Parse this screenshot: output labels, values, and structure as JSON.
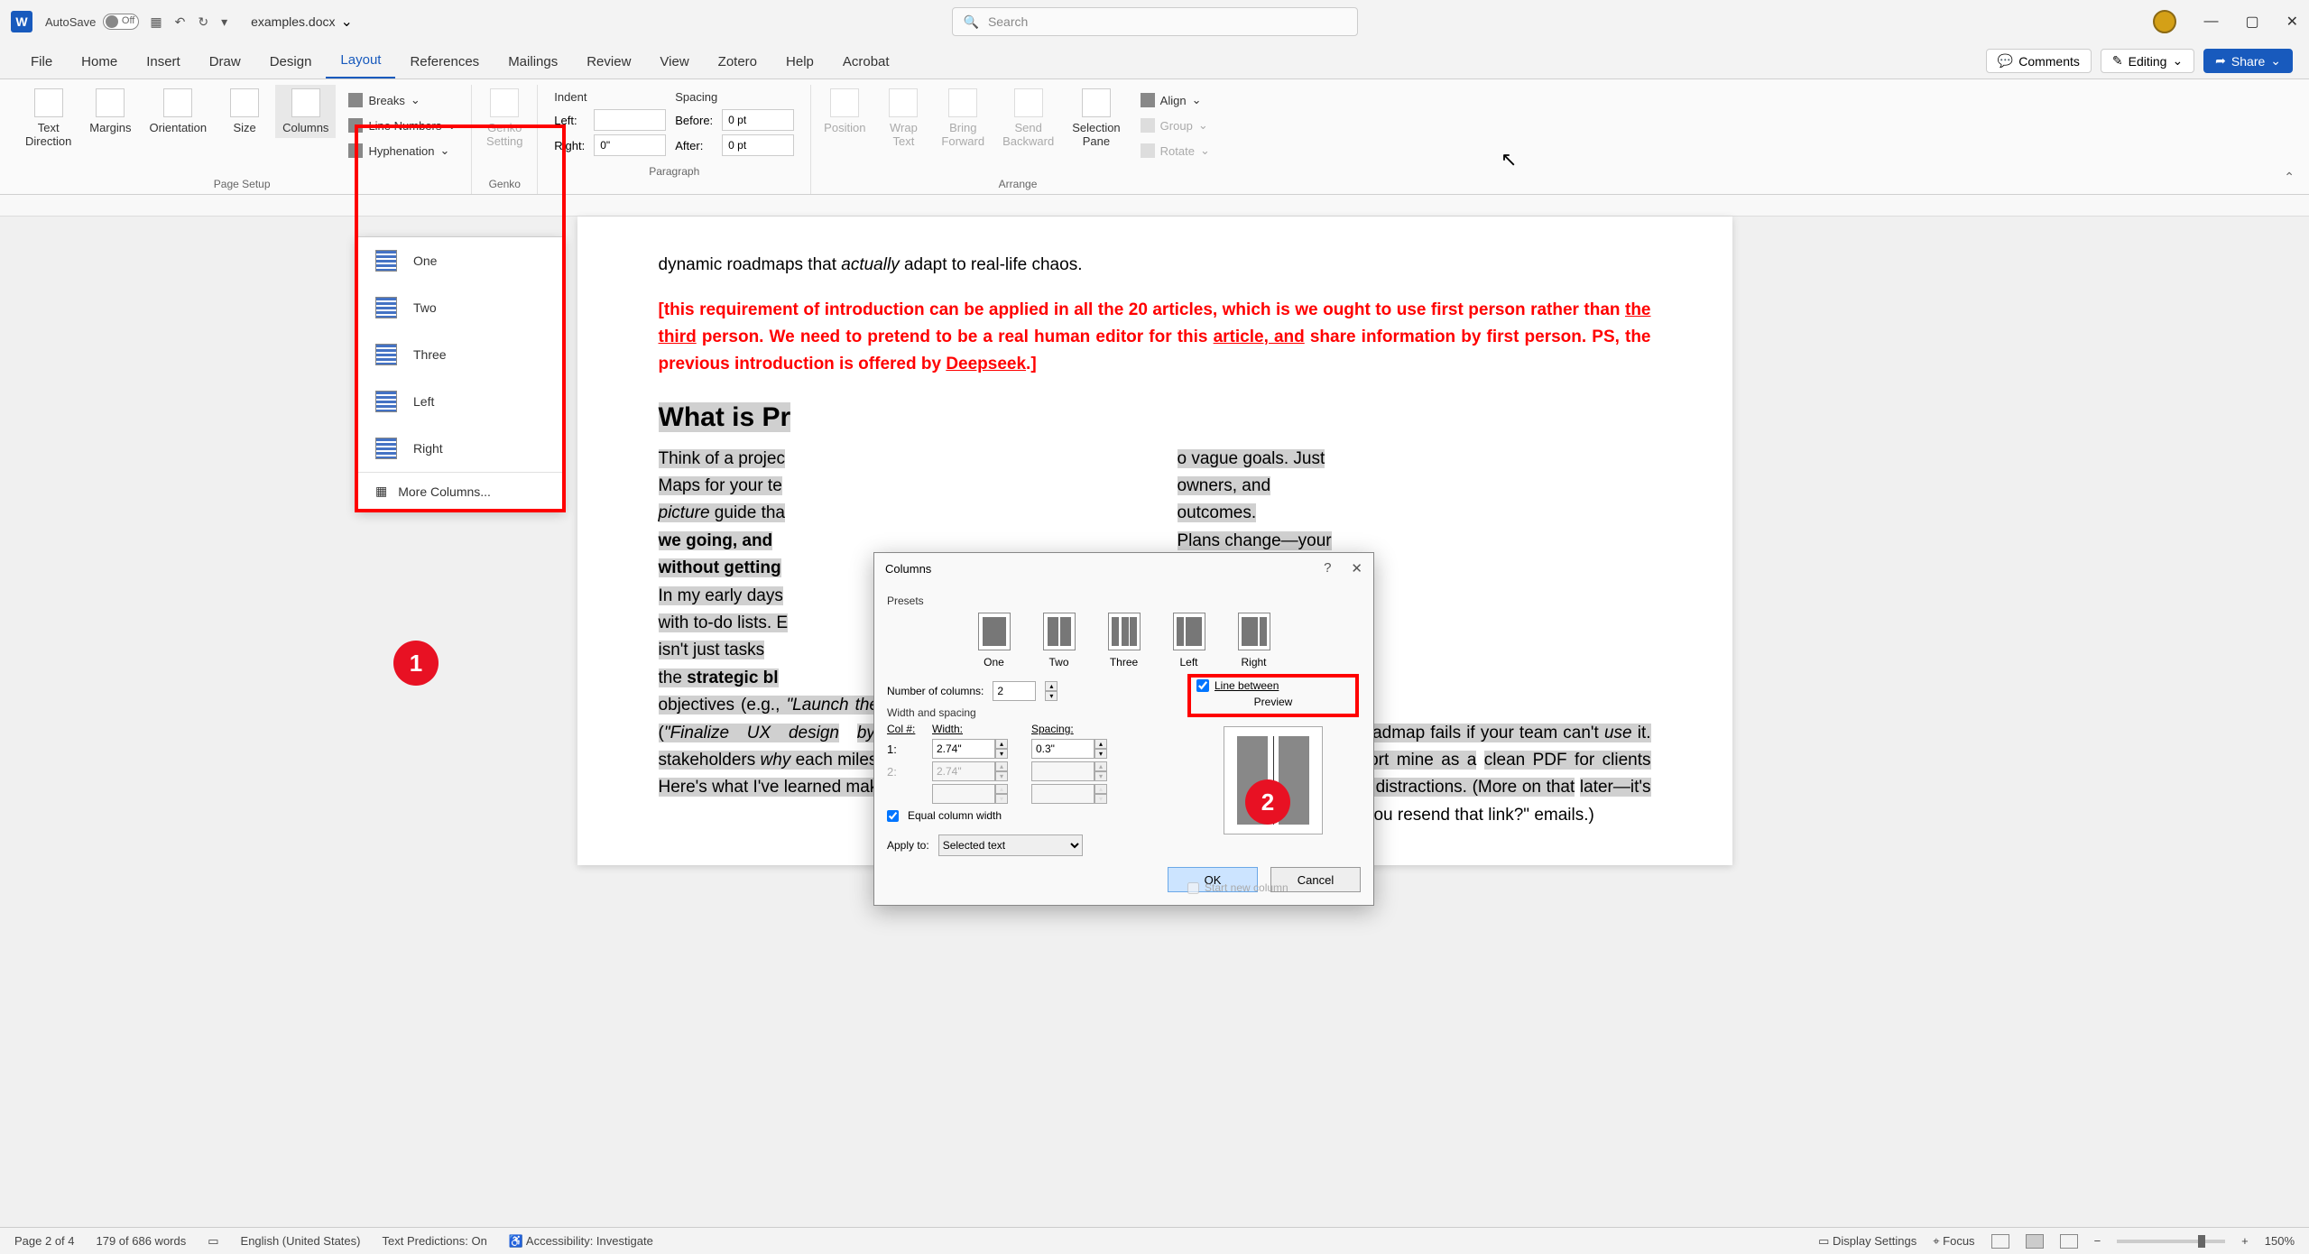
{
  "titlebar": {
    "autosave": "AutoSave",
    "autosave_state": "Off",
    "docname": "examples.docx",
    "search_placeholder": "Search"
  },
  "tabs": {
    "items": [
      "File",
      "Home",
      "Insert",
      "Draw",
      "Design",
      "Layout",
      "References",
      "Mailings",
      "Review",
      "View",
      "Zotero",
      "Help",
      "Acrobat"
    ],
    "active": "Layout",
    "comments": "Comments",
    "editing": "Editing",
    "share": "Share"
  },
  "ribbon": {
    "page_setup": {
      "text_direction": "Text\nDirection",
      "margins": "Margins",
      "orientation": "Orientation",
      "size": "Size",
      "columns": "Columns",
      "breaks": "Breaks",
      "line_numbers": "Line Numbers",
      "hyphenation": "Hyphenation",
      "label": "Page Setup"
    },
    "genko": {
      "btn": "Genko\nSetting",
      "label": "Genko"
    },
    "paragraph": {
      "indent_hdr": "Indent",
      "spacing_hdr": "Spacing",
      "left_lbl": "Left:",
      "left_val": "",
      "right_lbl": "Right:",
      "right_val": "0\"",
      "before_lbl": "Before:",
      "before_val": "0 pt",
      "after_lbl": "After:",
      "after_val": "0 pt",
      "label": "Paragraph"
    },
    "arrange": {
      "position": "Position",
      "wrap_text": "Wrap\nText",
      "bring_forward": "Bring\nForward",
      "send_backward": "Send\nBackward",
      "selection_pane": "Selection\nPane",
      "align": "Align",
      "group": "Group",
      "rotate": "Rotate",
      "label": "Arrange"
    }
  },
  "columns_menu": {
    "one": "One",
    "two": "Two",
    "three": "Three",
    "left": "Left",
    "right": "Right",
    "more": "More Columns..."
  },
  "badges": {
    "one": "1",
    "two": "2"
  },
  "document": {
    "intro_tail": "dynamic roadmaps that actually adapt to real-life chaos.",
    "red_note_1": "[this requirement of introduction can be applied in all the 20 articles, which is we ought to use first person rather than ",
    "red_note_third": "the third",
    "red_note_2": " person. We need to pretend to be a real human editor for this ",
    "red_note_article": "article, and",
    "red_note_3": " share information by first person. PS, the previous introduction is offered by ",
    "red_note_deepseek": "Deepseek",
    "red_note_4": ".]",
    "heading": "What is Pr",
    "col_left": "Think of a project<br>Maps for your tea<br><em>picture</em> guide tha<br><strong>we going, and</strong><br><strong>without getting</strong><br>In my early days<br>with to-do lists. E<br>isn't just tasks<br>the <strong>strategic bl</strong><br>objectives (e.g., <em>\"Launch the app by Q3\"</em>) to actionable steps (<em>\"Finalize UX design by April 15th\"</em>), while showing stakeholders <em>why</em> each milestone matters.<br>Here's what I've learned makes a roadmap actually useful:",
    "col_right": "o vague goals. Just<br>owners, and<br>outcomes.<br>Plans change—your<br>ould too (that's where<br>es).<br><strong>plicity</strong>: A cluttered<br>s worse than none.<br>ey phases, not every<br><br>n bomb: Even the best roadmap fails if your team can't <em>use</em> it. That's why I always export mine as a clean PDF for clients and execs—no logins, no distractions. (More on that later—it's saved me <em>hours</em> of \"Can you resend that link?\" emails.)"
  },
  "dialog": {
    "title": "Columns",
    "presets_label": "Presets",
    "presets": [
      "One",
      "Two",
      "Three",
      "Left",
      "Right"
    ],
    "num_cols_label": "Number of columns:",
    "num_cols_value": "2",
    "line_between_label": "Line between",
    "line_between_checked": true,
    "preview_label": "Preview",
    "width_spacing_label": "Width and spacing",
    "col_hdr": "Col #:",
    "width_hdr": "Width:",
    "spacing_hdr": "Spacing:",
    "rows": [
      {
        "n": "1:",
        "w": "2.74\"",
        "s": "0.3\""
      },
      {
        "n": "2:",
        "w": "2.74\"",
        "s": ""
      }
    ],
    "equal_width": "Equal column width",
    "apply_to_label": "Apply to:",
    "apply_to_value": "Selected text",
    "start_new_col": "Start new column",
    "ok": "OK",
    "cancel": "Cancel"
  },
  "statusbar": {
    "page": "Page 2 of 4",
    "words": "179 of 686 words",
    "lang": "English (United States)",
    "predictions": "Text Predictions: On",
    "accessibility": "Accessibility: Investigate",
    "display": "Display Settings",
    "focus": "Focus",
    "zoom": "150%"
  }
}
